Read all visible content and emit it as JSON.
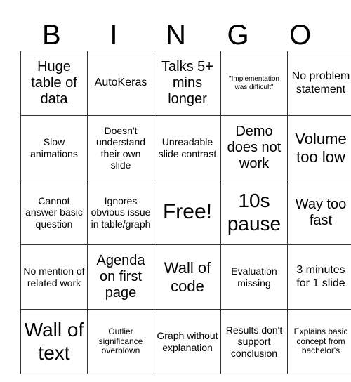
{
  "header": {
    "letters": [
      "B",
      "I",
      "N",
      "G",
      "O"
    ]
  },
  "rows": [
    [
      "Huge table of data",
      "AutoKeras",
      "Talks 5+ mins longer",
      "\"Implementation was difficult\"",
      "No problem statement"
    ],
    [
      "Slow animations",
      "Doesn't understand their own slide",
      "Unreadable slide contrast",
      "Demo does not work",
      "Volume too low"
    ],
    [
      "Cannot answer basic question",
      "Ignores obvious issue in table/graph",
      "Free!",
      "10s pause",
      "Way too fast"
    ],
    [
      "No mention of related work",
      "Agenda on first page",
      "Wall of code",
      "Evaluation missing",
      "3 minutes for 1 slide"
    ],
    [
      "Wall of text",
      "Outlier significance overblown",
      "Graph without explanation",
      "Results don't support conclusion",
      "Explains basic concept from bachelor's"
    ]
  ]
}
